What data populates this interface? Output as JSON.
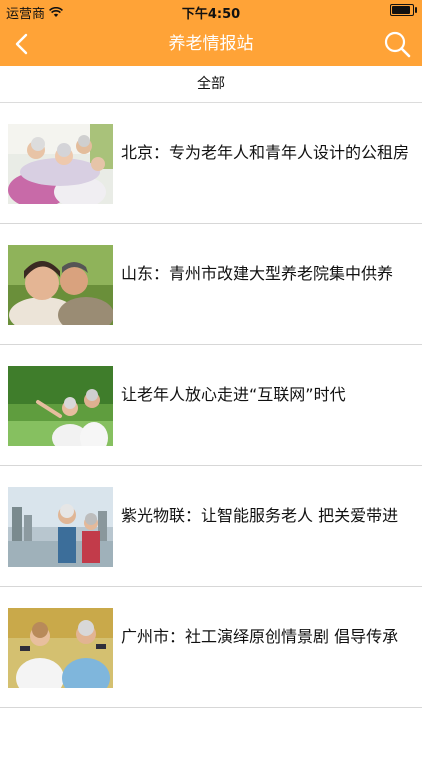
{
  "status": {
    "carrier": "运营商",
    "time": "下午4:50",
    "battery_level": 0.9
  },
  "nav": {
    "title": "养老情报站",
    "back_icon": "chevron-left-icon",
    "search_icon": "search-icon"
  },
  "category": {
    "label": "全部"
  },
  "colors": {
    "accent": "#ffa337"
  },
  "news": [
    {
      "title": "北京：专为老年人和青年人设计的公租房"
    },
    {
      "title": "山东：青州市改建大型养老院集中供养"
    },
    {
      "title": "让老年人放心走进“互联网”时代"
    },
    {
      "title": "紫光物联：让智能服务老人 把关爱带进"
    },
    {
      "title": "广州市：社工演绎原创情景剧 倡导传承"
    },
    {
      "title": ""
    }
  ]
}
